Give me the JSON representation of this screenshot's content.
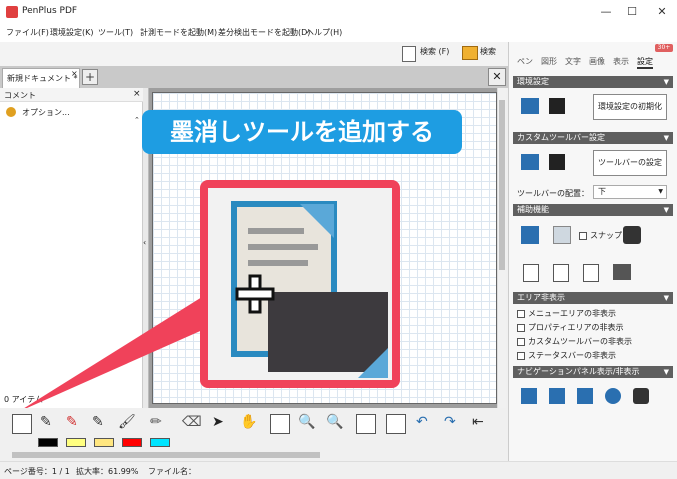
{
  "app": {
    "title": "PenPlus PDF"
  },
  "window_controls": {
    "minimize": "—",
    "maximize": "☐",
    "close": "✕"
  },
  "menu": [
    "ファイル(F)",
    "環境設定(K)",
    "ツール(T)",
    "計測モードを起動(M)",
    "差分検出モードを起動(D)",
    "ヘルプ(H)"
  ],
  "toolbar": {
    "search1": "検索 (F)",
    "search2": "検索"
  },
  "tabs": {
    "doc_tab": "新規ドキュメント *",
    "tab_close": "×",
    "add": "+",
    "close_all": "✕"
  },
  "comment_panel": {
    "title": "コメント",
    "close": "×",
    "options": "オプション...",
    "count": "0 アイテム"
  },
  "callout": {
    "banner": "墨消しツールを追加する"
  },
  "colors": {
    "accent": "#1e9de2",
    "callout_border": "#f0425a",
    "swatches": [
      "#000000",
      "#ffff80",
      "#ffe680",
      "#ff0000",
      "#00e5ff"
    ]
  },
  "status": {
    "page": "ページ番号：1 / 1",
    "zoom": "拡大率：61.99%",
    "file": "ファイル名："
  },
  "right_panel": {
    "badge": "30+",
    "tabs": [
      "ペン",
      "図形",
      "文字",
      "画像",
      "表示",
      "設定"
    ],
    "active_tab": "設定",
    "sec_env": "環境設定",
    "reset_env": "環境設定の初期化",
    "sec_toolbar": "カスタムツールバー設定",
    "toolbar_settings": "ツールバーの設定",
    "placement_label": "ツールバーの配置：",
    "placement_value": "下",
    "sec_assist": "補助機能",
    "snap": "スナップ",
    "sec_area": "エリア非表示",
    "hide_items": [
      "メニューエリアの非表示",
      "プロパティエリアの非表示",
      "カスタムツールバーの非表示",
      "ステータスバーの非表示"
    ],
    "sec_nav": "ナビゲーションパネル表示/非表示"
  }
}
